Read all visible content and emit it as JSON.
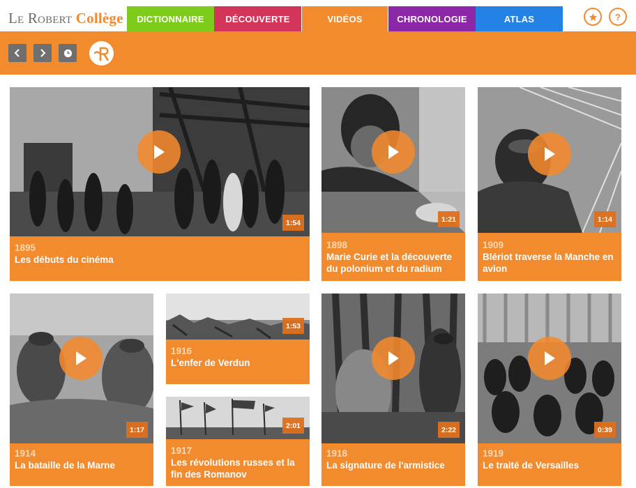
{
  "header": {
    "logo_part1": "Le Robert",
    "logo_part2": "Collège",
    "tabs": [
      {
        "label": "DICTIONNAIRE",
        "color": "#7fcb1c"
      },
      {
        "label": "DÉCOUVERTE",
        "color": "#d2345a"
      },
      {
        "label": "VIDÉOS",
        "color": "#f28a2e",
        "active": true
      },
      {
        "label": "CHRONOLOGIE",
        "color": "#8c27a8"
      },
      {
        "label": "ATLAS",
        "color": "#2482e6"
      }
    ],
    "favorites_icon": "star-icon",
    "help_icon": "question-icon",
    "help_symbol": "?"
  },
  "toolbar": {
    "back_icon": "chevron-left-icon",
    "forward_icon": "chevron-right-icon",
    "history_icon": "clock-icon",
    "brand_icon": "robert-r-logo-icon"
  },
  "videos": [
    {
      "year": "1895",
      "title": "Les débuts du cinéma",
      "duration": "1:54"
    },
    {
      "year": "1898",
      "title": "Marie Curie et la découverte du polonium et du radium",
      "duration": "1:21"
    },
    {
      "year": "1909",
      "title": "Blériot traverse la Manche en avion",
      "duration": "1:14"
    },
    {
      "year": "1914",
      "title": "La bataille de la Marne",
      "duration": "1:17"
    },
    {
      "year": "1916",
      "title": "L'enfer de Verdun",
      "duration": "1:53"
    },
    {
      "year": "1917",
      "title": "Les révolutions russes et la fin des Romanov",
      "duration": "2:01"
    },
    {
      "year": "1918",
      "title": "La signature de l'armistice",
      "duration": "2:22"
    },
    {
      "year": "1919",
      "title": "Le traité de Versailles",
      "duration": "0:39"
    }
  ],
  "colors": {
    "accent": "#f28a2e",
    "year_text": "#ffd7b0",
    "toolbar_button": "#6f6f6f"
  }
}
